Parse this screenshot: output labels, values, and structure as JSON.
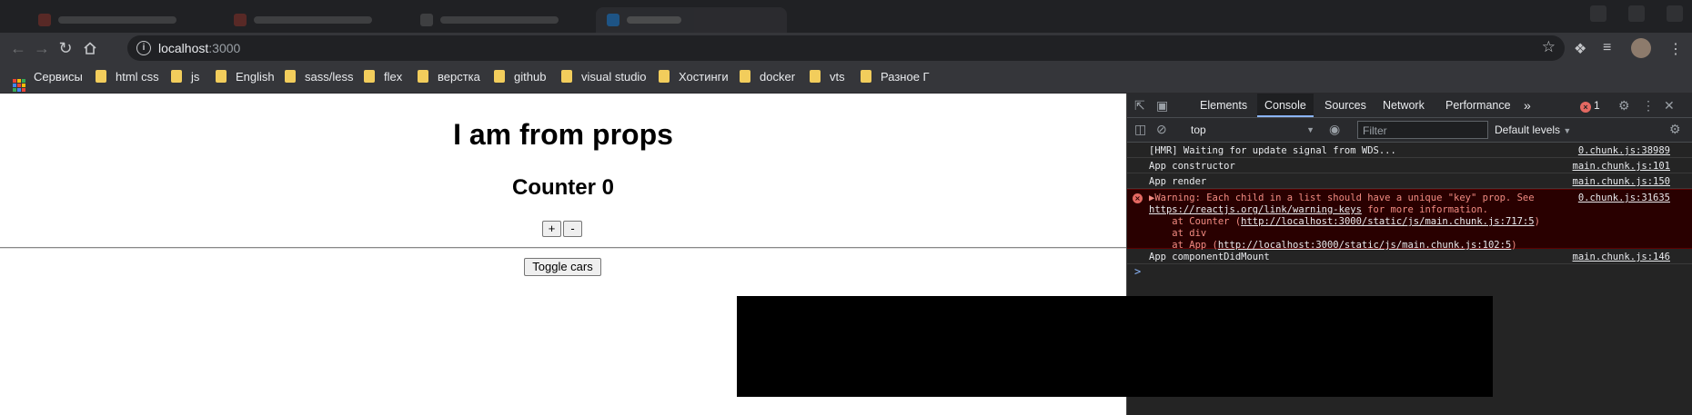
{
  "browser": {
    "address": {
      "host": "localhost",
      "port": ":3000"
    },
    "bookmarks": [
      "Сервисы",
      "html css",
      "js",
      "English",
      "sass/less",
      "flex",
      "верстка",
      "github",
      "visual studio",
      "Хостинги",
      "docker",
      "vts",
      "Разное Г"
    ]
  },
  "page": {
    "title": "I am from props",
    "counter_label": "Counter 0",
    "plus_label": "+",
    "minus_label": "-",
    "toggle_label": "Toggle cars"
  },
  "devtools": {
    "tabs": [
      "Elements",
      "Console",
      "Sources",
      "Network",
      "Performance"
    ],
    "active_tab": "Console",
    "more_tabs": "»",
    "error_count": "1",
    "context": "top",
    "filter_placeholder": "Filter",
    "levels": "Default levels",
    "logs": [
      {
        "message": "[HMR] Waiting for update signal from WDS...",
        "source": "0.chunk.js:38989"
      },
      {
        "message": "App constructor",
        "source": "main.chunk.js:101"
      },
      {
        "message": "App render",
        "source": "main.chunk.js:150"
      },
      {
        "message": "App componentDidMount",
        "source": "main.chunk.js:146"
      }
    ],
    "error": {
      "line1": "▶Warning: Each child in a list should have a unique \"key\" prop. See",
      "link": "https://reactjs.org/link/warning-keys",
      "line2_rest": " for more information.",
      "at1_prefix": "    at Counter (",
      "at1_link": "http://localhost:3000/static/js/main.chunk.js:717:5",
      "at1_suffix": ")",
      "at2": "    at div",
      "at3_prefix": "    at App (",
      "at3_link": "http://localhost:3000/static/js/main.chunk.js:102:5",
      "at3_suffix": ")",
      "source": "0.chunk.js:31635"
    },
    "prompt": ">"
  },
  "colors": {
    "accent": "#8ab4f8",
    "error": "#f28b82",
    "folder": "#f2cd5c"
  }
}
